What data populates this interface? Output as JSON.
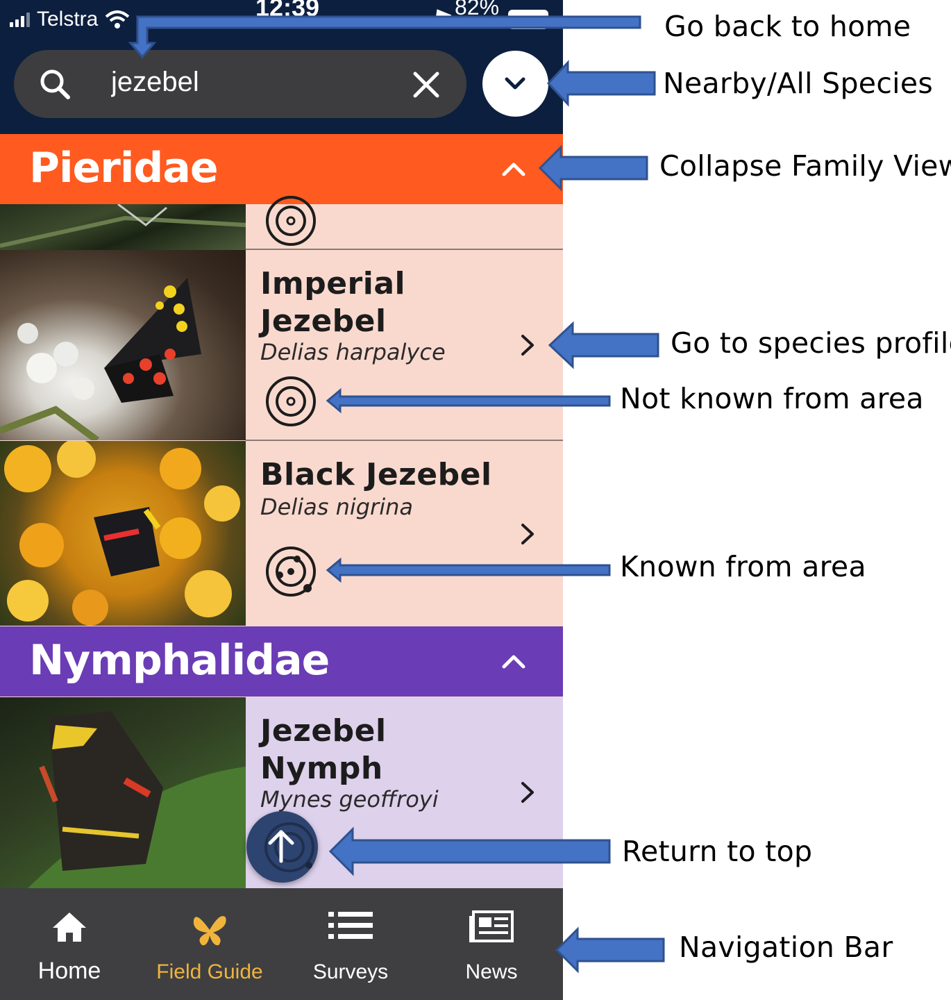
{
  "status_bar": {
    "carrier": "Telstra",
    "time": "12:39",
    "battery": "82%"
  },
  "search": {
    "value": "jezebel",
    "placeholder": ""
  },
  "families": [
    {
      "name": "Pieridae",
      "color": "#ff5a1f",
      "species": [
        {
          "common": "Imperial Jezebel",
          "common_lines": [
            "Imperial",
            "Jezebel"
          ],
          "scientific": "Delias harpalyce",
          "area_status": "not-known"
        },
        {
          "common": "Black Jezebel",
          "common_lines": [
            "Black Jezebel"
          ],
          "scientific": "Delias nigrina",
          "area_status": "known"
        }
      ]
    },
    {
      "name": "Nymphalidae",
      "color": "#6a3cb5",
      "species": [
        {
          "common": "Jezebel Nymph",
          "common_lines": [
            "Jezebel",
            "Nymph"
          ],
          "scientific": "Mynes geoffroyi",
          "area_status": "unknown"
        }
      ]
    }
  ],
  "nav": {
    "items": [
      {
        "label": "Home",
        "icon": "home-icon",
        "active": false
      },
      {
        "label": "Field Guide",
        "icon": "butterfly-icon",
        "active": true
      },
      {
        "label": "Surveys",
        "icon": "list-icon",
        "active": false
      },
      {
        "label": "News",
        "icon": "newspaper-icon",
        "active": false
      }
    ],
    "active_color": "#f0b43c"
  },
  "annotations": {
    "home": "Go back to home",
    "nearby": "Nearby/All Species",
    "collapse": "Collapse Family View",
    "profile": "Go to species profile",
    "not_known": "Not known from area",
    "known": "Known from area",
    "top": "Return to top",
    "navbar": "Navigation Bar"
  },
  "colors": {
    "arrow_fill": "#4472c4",
    "arrow_stroke": "#2f528f",
    "header_bg": "#0c1f3f",
    "pieridae_row": "#f9d9ce",
    "nymphalidae_row": "#ded1ec"
  }
}
